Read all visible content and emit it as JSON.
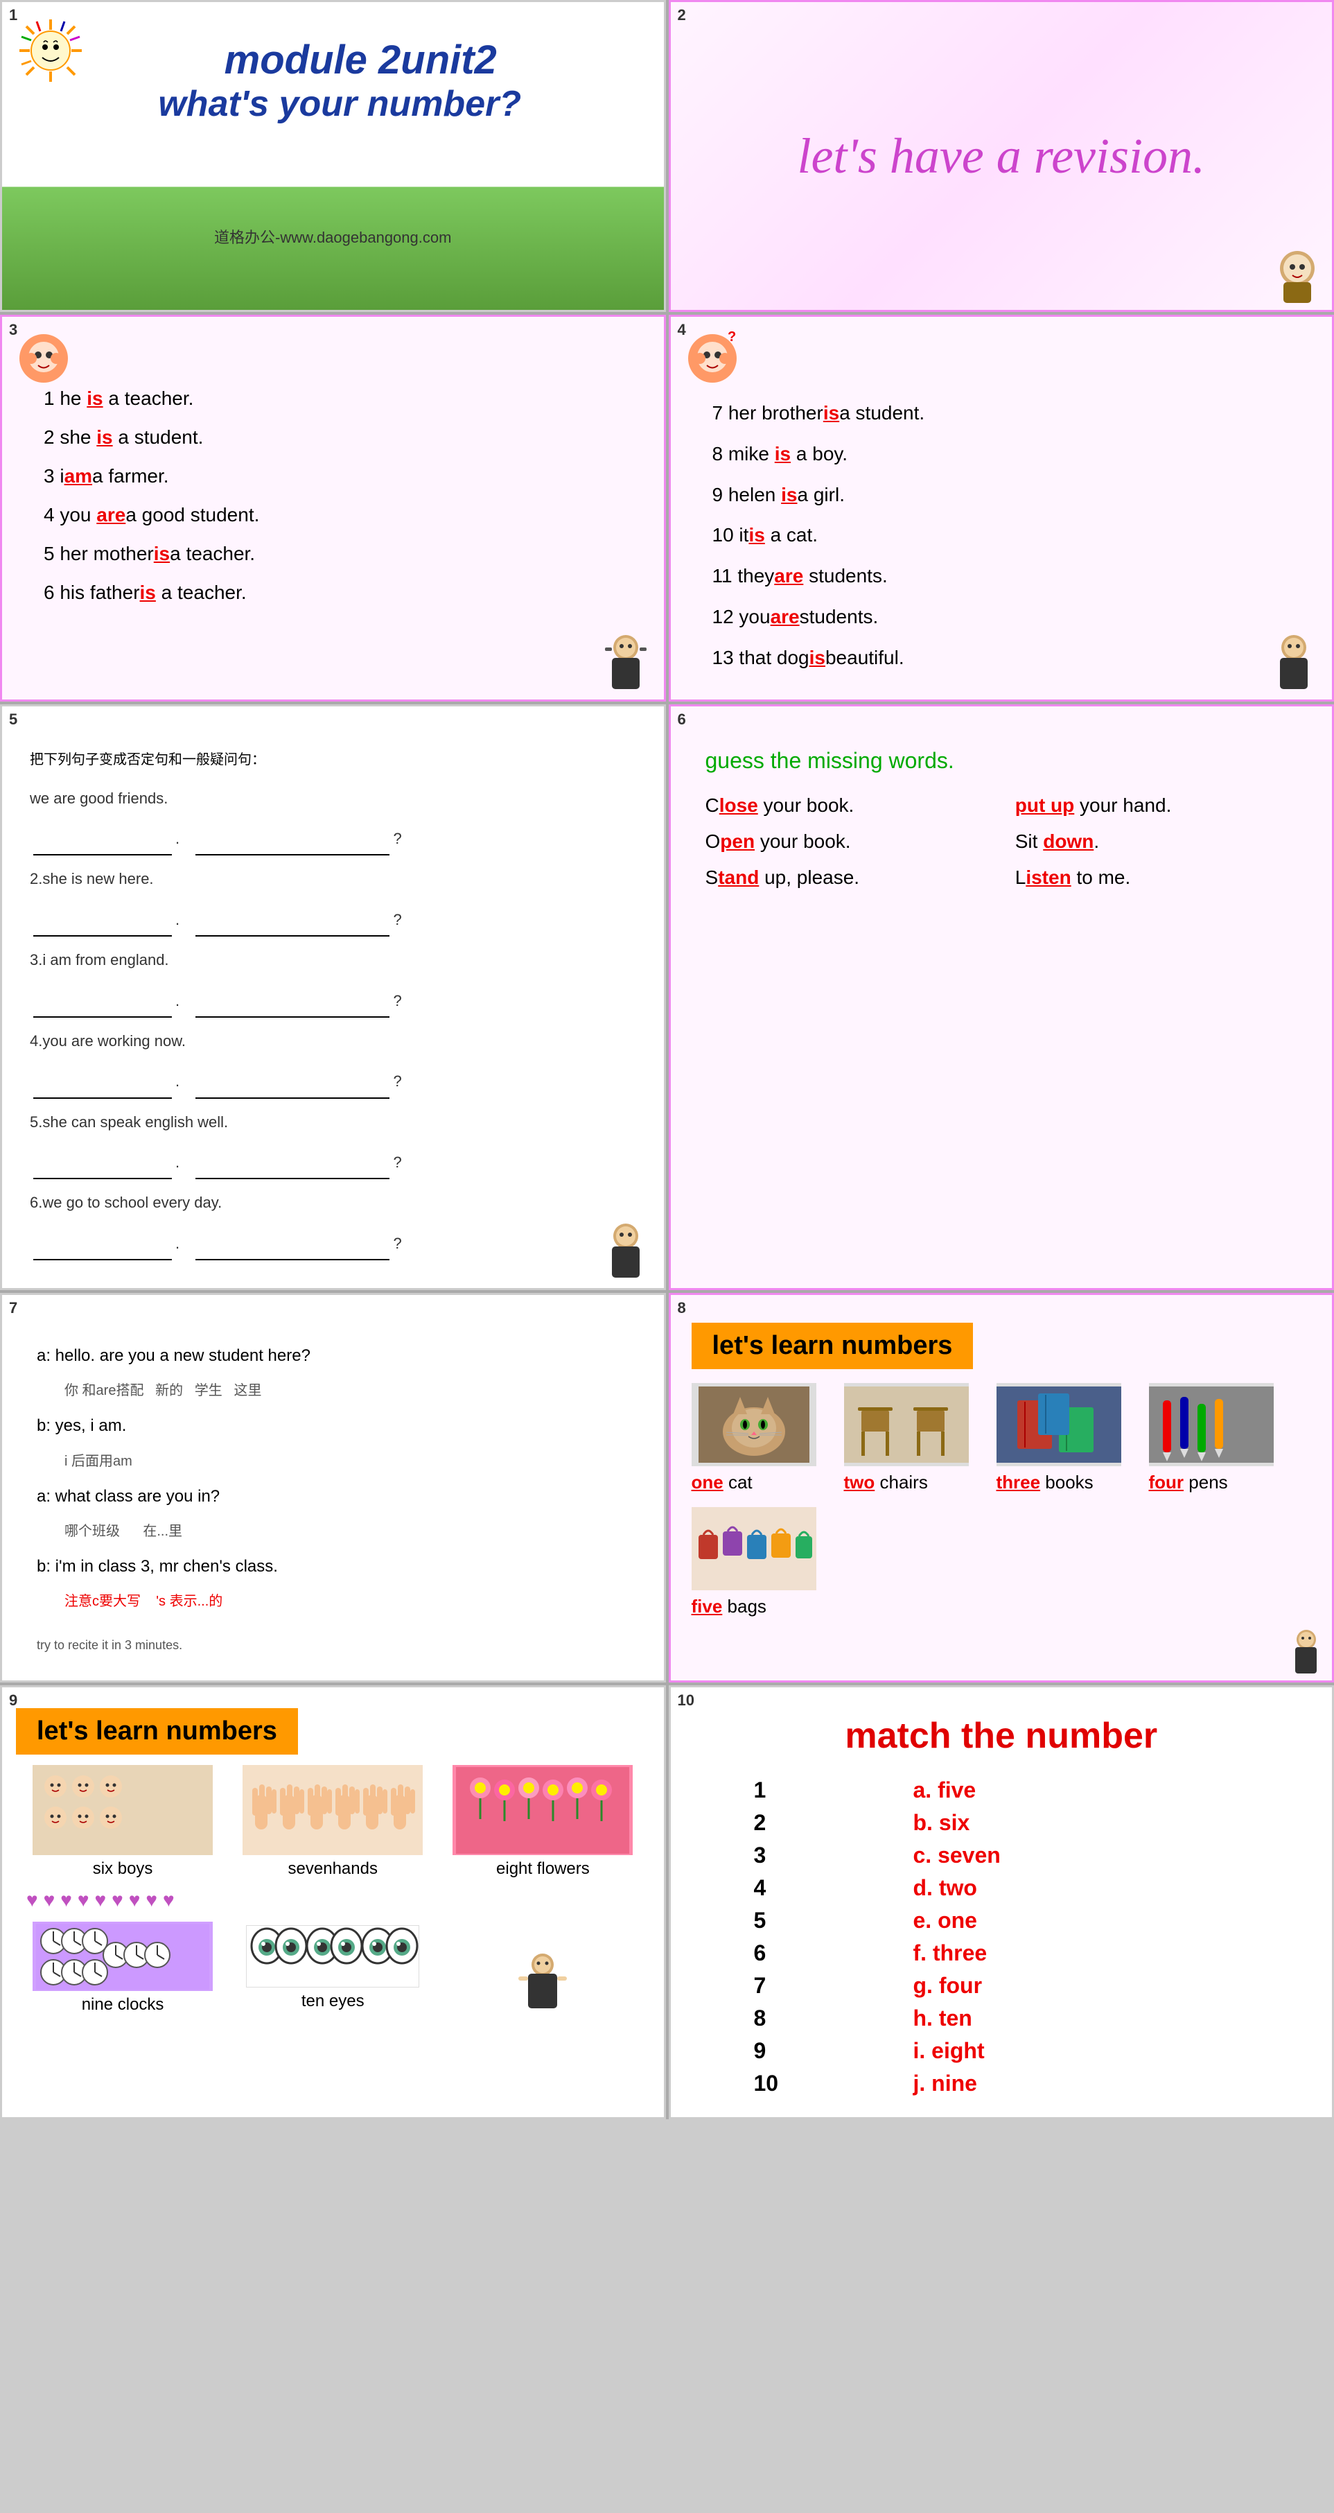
{
  "slide1": {
    "number": "1",
    "title_line1": "module 2unit2",
    "title_line2": "what's your number?",
    "website": "道格办公-www.daogebangong.com"
  },
  "slide2": {
    "number": "2",
    "text": "let's have a revision."
  },
  "slide3": {
    "number": "3",
    "sentences": [
      {
        "text": "1 he __is__ a teacher.",
        "parts": [
          "1 he ",
          "is",
          " a teacher."
        ]
      },
      {
        "text": "2 she __is__ a student.",
        "parts": [
          "2 she ",
          "is",
          " a student."
        ]
      },
      {
        "text": "3 i__am__a farmer.",
        "parts": [
          "3 i",
          "am",
          "a farmer."
        ]
      },
      {
        "text": "4 you __are__ a good student.",
        "parts": [
          "4 you ",
          "are",
          " a good student."
        ]
      },
      {
        "text": "5 her mother__is__a teacher.",
        "parts": [
          "5 her mother",
          "is",
          "a teacher."
        ]
      },
      {
        "text": "6 his father__is__ a teacher.",
        "parts": [
          "6 his father",
          "is",
          " a teacher."
        ]
      }
    ]
  },
  "slide4": {
    "number": "4",
    "sentences": [
      {
        "parts": [
          "7 her brother",
          "is",
          "a student."
        ]
      },
      {
        "parts": [
          "8 mike ",
          "is",
          " a boy."
        ]
      },
      {
        "parts": [
          "9 helen ",
          "is",
          "a girl."
        ]
      },
      {
        "parts": [
          "10 it",
          "is",
          " a cat."
        ]
      },
      {
        "parts": [
          "11 they",
          "are",
          " students."
        ]
      },
      {
        "parts": [
          "12 you",
          "are",
          "students."
        ]
      },
      {
        "parts": [
          "13 that dog",
          "is",
          "beautiful."
        ]
      }
    ]
  },
  "slide5": {
    "number": "5",
    "instructions": "把下列句子变成否定句和一般疑问句：",
    "items": [
      {
        "sentence": "we are good friends.",
        "neg": "",
        "quest": ""
      },
      {
        "sentence": "2.she is new here.",
        "neg": "",
        "quest": ""
      },
      {
        "sentence": "3.i am from england.",
        "neg": "",
        "quest": ""
      },
      {
        "sentence": "4.you are working now.",
        "neg": "",
        "quest": ""
      },
      {
        "sentence": "5.she can speak english well.",
        "neg": "",
        "quest": ""
      },
      {
        "sentence": "6.we go to school every day.",
        "neg": "",
        "quest": ""
      }
    ]
  },
  "slide6": {
    "number": "6",
    "title": "guess the missing words.",
    "items": [
      {
        "prefix": "C",
        "fill": "lose",
        "suffix": " your book.",
        "col": 1
      },
      {
        "prefix": "",
        "fill": "put up",
        "suffix": " your hand.",
        "col": 2
      },
      {
        "prefix": "O",
        "fill": "pen",
        "suffix": " your book.",
        "col": 1
      },
      {
        "prefix": "Sit ",
        "fill": "down",
        "suffix": ".",
        "col": 2
      },
      {
        "prefix": "S",
        "fill": "tand",
        "suffix": " up, please.",
        "col": 1
      },
      {
        "prefix": "L",
        "fill": "isten",
        "suffix": " to me.",
        "col": 2
      }
    ]
  },
  "slide7": {
    "number": "7",
    "lines": [
      {
        "text": "a: hello. are you a new student here?"
      },
      {
        "text": "    你  和are搭配   新的   学生   这里",
        "annotation": true
      },
      {
        "text": "b: yes, i am."
      },
      {
        "text": "    i 后面用am",
        "annotation": true
      },
      {
        "text": "a: what class are you in?"
      },
      {
        "text": "    哪个班级        在...里",
        "annotation": true
      },
      {
        "text": "b: i'm in class 3, mr chen's class."
      },
      {
        "text": "    注意c要大写    's 表示...的",
        "annotation": true,
        "red": true
      },
      {
        "text": ""
      },
      {
        "text": "try to recite it in 3 minutes.",
        "small": true
      }
    ]
  },
  "slide8": {
    "number": "8",
    "banner": "let's learn numbers",
    "items": [
      {
        "fill": "one",
        "label_after": " cat",
        "img_class": "img-cat",
        "img_label": "cat"
      },
      {
        "fill": "two",
        "label_after": " chairs",
        "img_class": "img-chairs",
        "img_label": "chairs"
      },
      {
        "fill": "three",
        "label_after": " books",
        "img_class": "img-books",
        "img_label": "books"
      },
      {
        "fill": "four",
        "label_after": " pens",
        "img_class": "img-pens",
        "img_label": "pens"
      },
      {
        "fill": "five",
        "label_after": " bags",
        "img_class": "img-bags",
        "img_label": "bags"
      }
    ]
  },
  "slide9": {
    "number": "9",
    "banner": "let's learn numbers",
    "items": [
      {
        "fill": "six",
        "label_after": " boys",
        "img_class": "img-boys",
        "img_label": "six boys"
      },
      {
        "fill": "seven",
        "label_after": "hands",
        "img_class": "img-hands",
        "img_label": "7 hands"
      },
      {
        "fill": "eight",
        "label_after": " flowers",
        "img_class": "img-flowers",
        "img_label": "8 flowers"
      },
      {
        "fill": "nine",
        "label_after": " clocks",
        "img_class": "img-clocks",
        "img_label": "9 clocks"
      },
      {
        "fill": "ten",
        "label_after": " eyes",
        "img_class": "img-eyes",
        "img_label": "10 eyes"
      }
    ],
    "hearts": [
      "♥",
      "♥",
      "♥",
      "♥",
      "♥",
      "♥",
      "♥",
      "♥",
      "♥"
    ]
  },
  "slide10": {
    "number": "10",
    "title": "match the number",
    "left": [
      "1",
      "2",
      "3",
      "4",
      "5",
      "6",
      "7",
      "8",
      "9",
      "10"
    ],
    "right": [
      "a. five",
      "b. six",
      "c. seven",
      "d. two",
      "e. one",
      "f. three",
      "g. four",
      "h. ten",
      "i. eight",
      "j. nine"
    ]
  }
}
